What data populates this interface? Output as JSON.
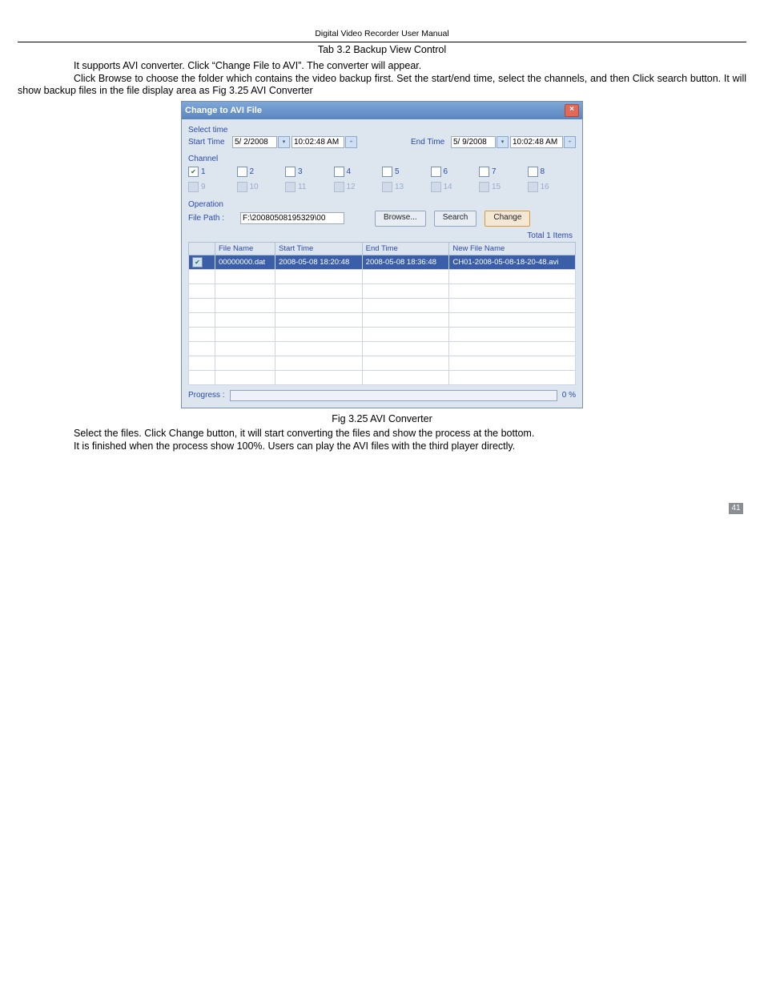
{
  "header": "Digital Video Recorder User Manual",
  "tab_caption": "Tab 3.2 Backup View Control",
  "para1": "It supports AVI converter. Click “Change File to AVI”. The converter will appear.",
  "para2": "Click Browse to choose the folder which contains the video backup first. Set the start/end time, select the channels, and then Click search button. It will show backup files in the file display area as Fig 3.25 AVI Converter",
  "dialog": {
    "title": "Change to AVI File",
    "select_time_label": "Select time",
    "start_time_label": "Start Time",
    "start_date": "5/ 2/2008",
    "start_clock": "10:02:48 AM",
    "end_time_label": "End Time",
    "end_date": "5/ 9/2008",
    "end_clock": "10:02:48 AM",
    "channel_label": "Channel",
    "channels_row1": [
      "1",
      "2",
      "3",
      "4",
      "5",
      "6",
      "7",
      "8"
    ],
    "channels_row2": [
      "9",
      "10",
      "11",
      "12",
      "13",
      "14",
      "15",
      "16"
    ],
    "operation_label": "Operation",
    "file_path_label": "File Path :",
    "file_path_value": "F:\\20080508195329\\00",
    "browse_btn": "Browse...",
    "search_btn": "Search",
    "change_btn": "Change",
    "total_items": "Total 1 Items",
    "table": {
      "headers": [
        "",
        "File Name",
        "Start Time",
        "End Time",
        "New File Name"
      ],
      "row": {
        "file_name": "00000000.dat",
        "start": "2008-05-08 18:20:48",
        "end": "2008-05-08 18:36:48",
        "new_name": "CH01-2008-05-08-18-20-48.avi"
      }
    },
    "progress_label": "Progress :",
    "progress_pct": "0 %"
  },
  "fig_caption": "Fig 3.25 AVI Converter",
  "para3": "Select the files. Click Change button, it will start converting the files and show the process at the bottom.",
  "para4": "It is finished when the process show 100%. Users can play the AVI files with the third player directly.",
  "page_number": "41"
}
